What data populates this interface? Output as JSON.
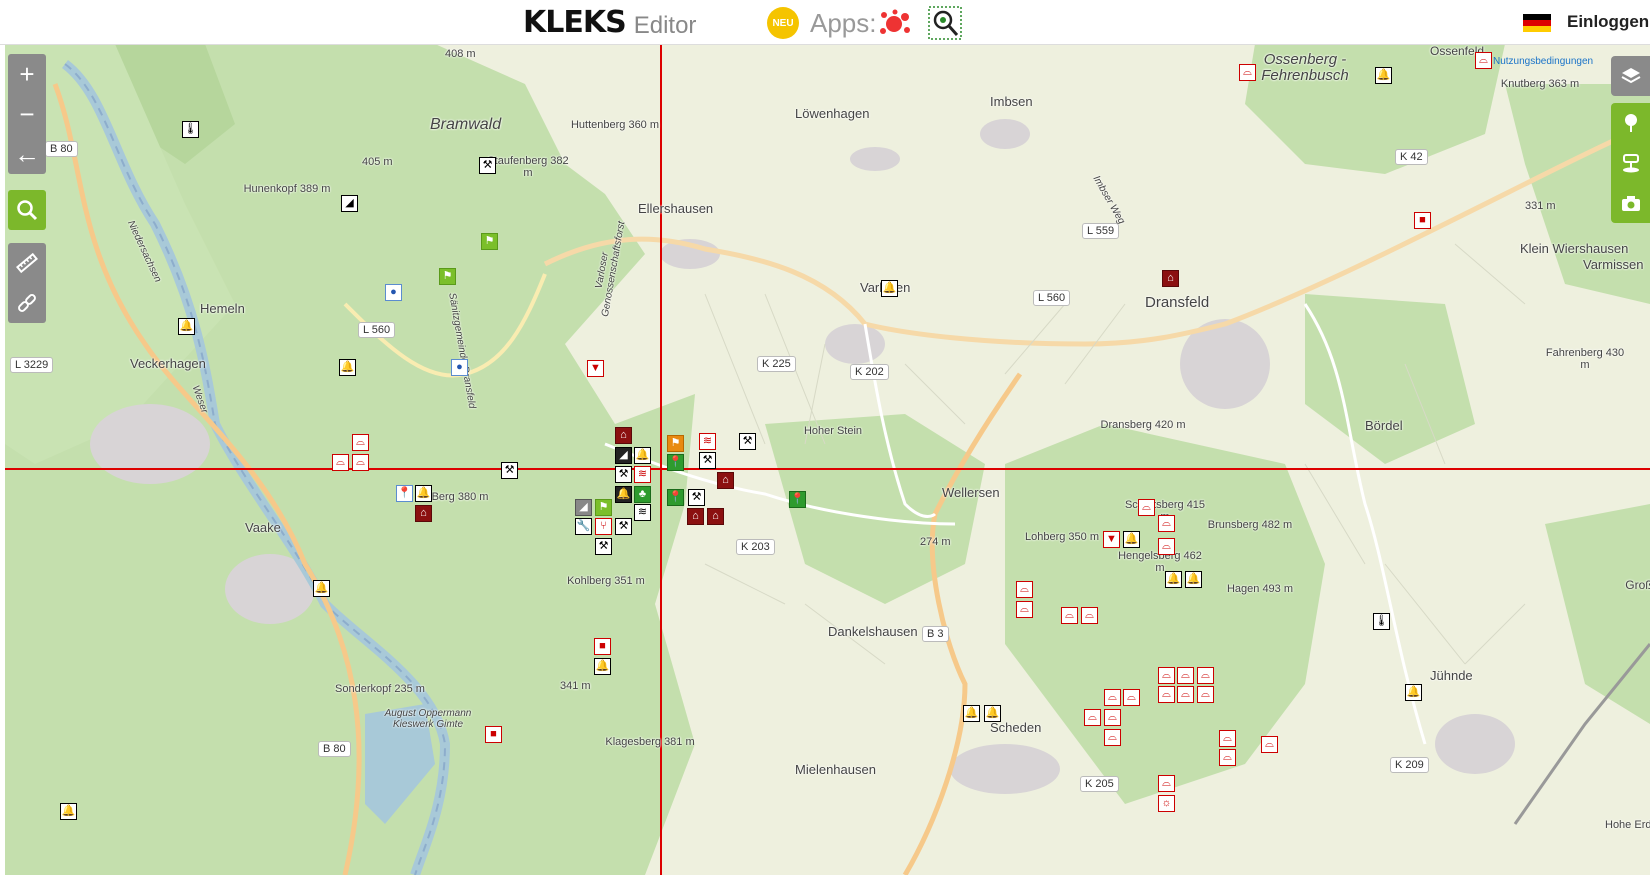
{
  "header": {
    "logo_text": "KLEKS",
    "logo_suffix": "Editor",
    "badge": "NEU",
    "apps_label": "Apps:",
    "login_label": "Einloggen",
    "flag": "de-flag-icon"
  },
  "map_controls": {
    "zoom_in": "+",
    "zoom_out": "−",
    "back": "←"
  },
  "terms_link": "Nutzungsbedingungen",
  "colors": {
    "forest": "#c4dfad",
    "field": "#eef0de",
    "river": "#a8c9d8",
    "crosshair": "#d00000",
    "accent_green": "#7cb82b"
  },
  "places": [
    {
      "text": "Bramwald",
      "cls": "big"
    },
    {
      "text": "Huttenberg 360 m"
    },
    {
      "text": "Staufenberg 382 m"
    },
    {
      "text": "405 m"
    },
    {
      "text": "408 m"
    },
    {
      "text": "Hunenkopf 389 m"
    },
    {
      "text": "Hemeln"
    },
    {
      "text": "Veckerhagen"
    },
    {
      "text": "Vaake"
    },
    {
      "text": "Ellershausen"
    },
    {
      "text": "Löwenhagen"
    },
    {
      "text": "Imbsen"
    },
    {
      "text": "Varlosen"
    },
    {
      "text": "Varloser Genossenschaftsforst"
    },
    {
      "text": "Sänitzgemeinde Dransfeld"
    },
    {
      "text": "Dransfeld"
    },
    {
      "text": "Ossenfeld"
    },
    {
      "text": "Ossenberg - Fehrenbusch"
    },
    {
      "text": "Knutberg 363 m"
    },
    {
      "text": "331 m"
    },
    {
      "text": "Klein Wiershausen"
    },
    {
      "text": "Varmissen"
    },
    {
      "text": "Fahrenberg 430 m"
    },
    {
      "text": "Bördel"
    },
    {
      "text": "Dransberg 420 m"
    },
    {
      "text": "Hoher Stein"
    },
    {
      "text": "Wellersen"
    },
    {
      "text": "274 m"
    },
    {
      "text": "Schottsberg 415 m"
    },
    {
      "text": "Lohberg 350 m"
    },
    {
      "text": "Hengelsberg 462 m"
    },
    {
      "text": "Brunsberg 482 m"
    },
    {
      "text": "Hagen 493 m"
    },
    {
      "text": "Dankelshausen"
    },
    {
      "text": "Kohlberg 351 m"
    },
    {
      "text": "341 m"
    },
    {
      "text": "Sonderkopf 235 m"
    },
    {
      "text": "August Oppermann Kieswerk Gimte"
    },
    {
      "text": "Klagesberg 381 m"
    },
    {
      "text": "Mielenhausen"
    },
    {
      "text": "Scheden"
    },
    {
      "text": "Jühnde"
    },
    {
      "text": "Hohe Erde"
    },
    {
      "text": "Groß Leinebu"
    },
    {
      "text": "Niedersachsen"
    },
    {
      "text": "Weser"
    },
    {
      "text": "Imbser Weg"
    },
    {
      "text": "Berg 380 m"
    }
  ],
  "roads": [
    "B 80",
    "L 560",
    "L 3229",
    "K 225",
    "K 202",
    "L 559",
    "L 560",
    "K 42",
    "K 203",
    "B 3",
    "K 205",
    "K 209",
    "B 80"
  ],
  "markers": [
    {
      "icon": "thermometer-icon"
    },
    {
      "icon": "hill-icon"
    },
    {
      "icon": "tools-icon"
    },
    {
      "icon": "flag-icon"
    },
    {
      "icon": "flag-icon"
    },
    {
      "icon": "dot-icon"
    },
    {
      "icon": "dot-icon"
    },
    {
      "icon": "bell-icon"
    },
    {
      "icon": "bell-icon"
    },
    {
      "icon": "triangle-down-icon"
    },
    {
      "icon": "arch-icon"
    },
    {
      "icon": "arch-icon"
    },
    {
      "icon": "arch-icon"
    },
    {
      "icon": "tools-icon"
    },
    {
      "icon": "pin-icon"
    },
    {
      "icon": "bell-icon"
    },
    {
      "icon": "house-icon"
    },
    {
      "icon": "bell-icon"
    },
    {
      "icon": "square-icon"
    },
    {
      "icon": "bell-icon"
    },
    {
      "icon": "square-icon"
    },
    {
      "icon": "bell-icon"
    },
    {
      "icon": "house-icon"
    },
    {
      "icon": "hill-icon"
    },
    {
      "icon": "bell-icon"
    },
    {
      "icon": "tools-icon"
    },
    {
      "icon": "rail-icon"
    },
    {
      "icon": "bell-icon"
    },
    {
      "icon": "trees-icon"
    },
    {
      "icon": "hill-icon"
    },
    {
      "icon": "flag-icon"
    },
    {
      "icon": "rail-icon"
    },
    {
      "icon": "wrench-icon"
    },
    {
      "icon": "fork-icon"
    },
    {
      "icon": "tools-icon"
    },
    {
      "icon": "tools-icon"
    },
    {
      "icon": "flag-icon"
    },
    {
      "icon": "rail-icon"
    },
    {
      "icon": "tools-icon"
    },
    {
      "icon": "tools-icon"
    },
    {
      "icon": "pin-icon"
    },
    {
      "icon": "pin-icon"
    },
    {
      "icon": "tools-icon"
    },
    {
      "icon": "house-icon"
    },
    {
      "icon": "house-icon"
    },
    {
      "icon": "house-icon"
    },
    {
      "icon": "pin-icon"
    },
    {
      "icon": "bell-icon"
    },
    {
      "icon": "bell-icon"
    },
    {
      "icon": "arch-icon"
    },
    {
      "icon": "square-icon"
    },
    {
      "icon": "house-icon"
    },
    {
      "icon": "arch-icon"
    },
    {
      "icon": "triangle-down-icon"
    },
    {
      "icon": "bell-icon"
    },
    {
      "icon": "arch-icon"
    },
    {
      "icon": "arch-icon"
    },
    {
      "icon": "arch-icon"
    },
    {
      "icon": "bell-icon"
    },
    {
      "icon": "bell-icon"
    },
    {
      "icon": "arch-icon"
    },
    {
      "icon": "arch-icon"
    },
    {
      "icon": "arch-icon"
    },
    {
      "icon": "arch-icon"
    },
    {
      "icon": "arch-icon"
    },
    {
      "icon": "arch-icon"
    },
    {
      "icon": "arch-icon"
    },
    {
      "icon": "arch-icon"
    },
    {
      "icon": "arch-icon"
    },
    {
      "icon": "arch-icon"
    },
    {
      "icon": "arch-icon"
    },
    {
      "icon": "arch-icon"
    },
    {
      "icon": "arch-icon"
    },
    {
      "icon": "arch-icon"
    },
    {
      "icon": "arch-icon"
    },
    {
      "icon": "arch-icon"
    },
    {
      "icon": "arch-icon"
    },
    {
      "icon": "arch-icon"
    },
    {
      "icon": "arch-icon"
    },
    {
      "icon": "sun-icon"
    },
    {
      "icon": "bell-icon"
    },
    {
      "icon": "bell-icon"
    },
    {
      "icon": "thermometer-icon"
    },
    {
      "icon": "bell-icon"
    }
  ]
}
